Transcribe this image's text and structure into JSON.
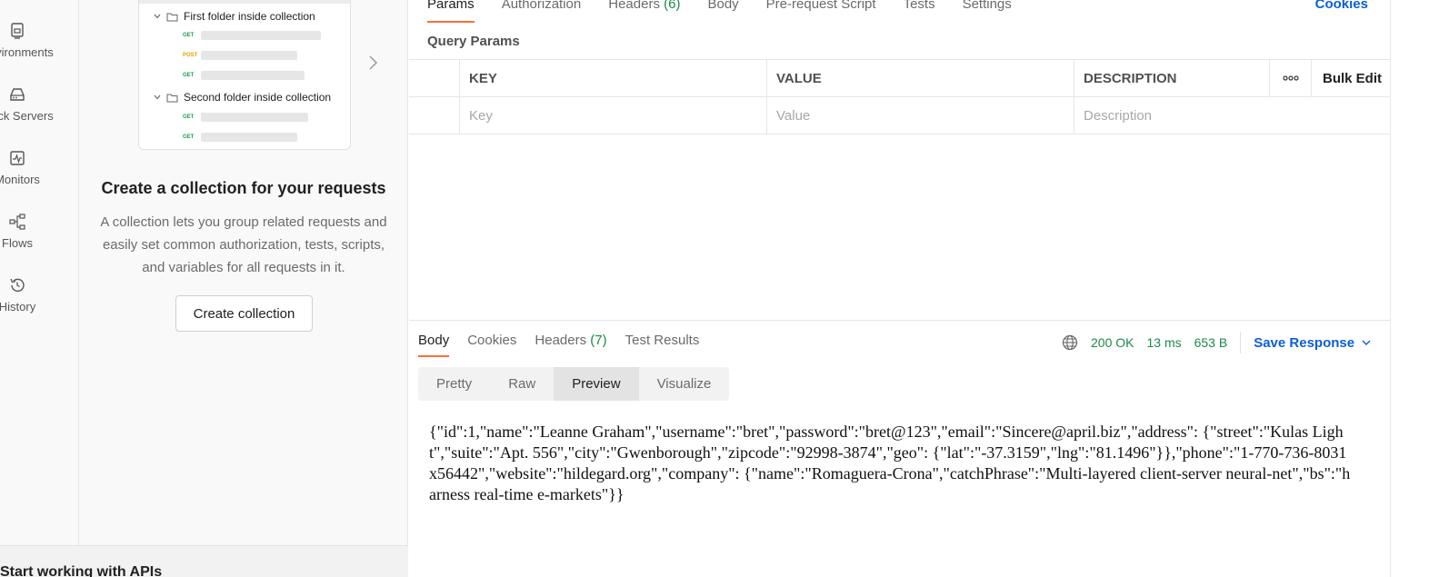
{
  "rail": {
    "items": [
      {
        "label": "Environments",
        "icon": "environment-icon"
      },
      {
        "label": "Mock Servers",
        "icon": "mock-server-icon"
      },
      {
        "label": "Monitors",
        "icon": "monitor-icon"
      },
      {
        "label": "Flows",
        "icon": "flows-icon"
      },
      {
        "label": "History",
        "icon": "history-icon"
      }
    ]
  },
  "sidebar": {
    "illustration": {
      "folder1": "First folder inside collection",
      "folder2": "Second folder inside collection",
      "methods": [
        "GET",
        "POST",
        "GET",
        "GET",
        "GET"
      ]
    },
    "title": "Create a collection for your requests",
    "description": "A collection lets you group related requests and easily set common authorization, tests, scripts, and variables for all requests in it.",
    "button": "Create collection",
    "start": "Start working with APIs"
  },
  "request": {
    "tabs": [
      {
        "label": "Params"
      },
      {
        "label": "Authorization"
      },
      {
        "label": "Headers ",
        "count": "(6)"
      },
      {
        "label": "Body"
      },
      {
        "label": "Pre-request Script"
      },
      {
        "label": "Tests"
      },
      {
        "label": "Settings"
      }
    ],
    "cookies": "Cookies",
    "query_params_title": "Query Params",
    "table": {
      "headers": [
        "KEY",
        "VALUE",
        "DESCRIPTION"
      ],
      "bulk_edit": "Bulk Edit",
      "placeholders": [
        "Key",
        "Value",
        "Description"
      ]
    }
  },
  "response": {
    "tabs": [
      {
        "label": "Body"
      },
      {
        "label": "Cookies"
      },
      {
        "label": "Headers ",
        "count": "(7)"
      },
      {
        "label": "Test Results"
      }
    ],
    "status": "200 OK",
    "time": "13 ms",
    "size": "653 B",
    "save": "Save Response",
    "views": [
      "Pretty",
      "Raw",
      "Preview",
      "Visualize"
    ],
    "body": "{\"id\":1,\"name\":\"Leanne Graham\",\"username\":\"bret\",\"password\":\"bret@123\",\"email\":\"Sincere@april.biz\",\"address\": {\"street\":\"Kulas Light\",\"suite\":\"Apt. 556\",\"city\":\"Gwenborough\",\"zipcode\":\"92998-3874\",\"geo\": {\"lat\":\"-37.3159\",\"lng\":\"81.1496\"}},\"phone\":\"1-770-736-8031 x56442\",\"website\":\"hildegard.org\",\"company\": {\"name\":\"Romaguera-Crona\",\"catchPhrase\":\"Multi-layered client-server neural-net\",\"bs\":\"harness real-time e-markets\"}}"
  },
  "colors": {
    "accent": "#ff6c37",
    "link": "#0b5ed7",
    "success": "#1a8a4a"
  }
}
